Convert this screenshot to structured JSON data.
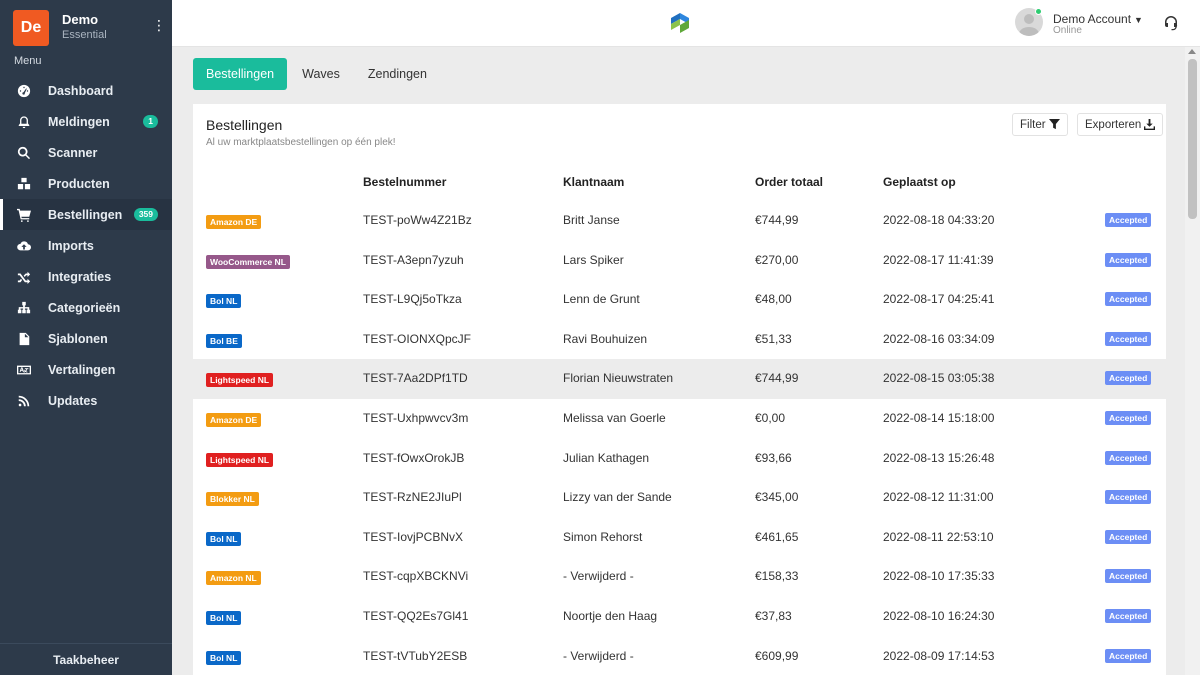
{
  "app": {
    "brand_initials": "De",
    "brand_name": "Demo",
    "brand_plan": "Essential",
    "menu_label": "Menu",
    "task_label": "Taakbeheer"
  },
  "sidebar": {
    "items": [
      {
        "label": "Dashboard",
        "icon": "dashboard-icon"
      },
      {
        "label": "Meldingen",
        "icon": "bell-icon",
        "badge": "1"
      },
      {
        "label": "Scanner",
        "icon": "search-icon"
      },
      {
        "label": "Producten",
        "icon": "boxes-icon"
      },
      {
        "label": "Bestellingen",
        "icon": "cart-icon",
        "badge": "359",
        "active": true
      },
      {
        "label": "Imports",
        "icon": "cloud-upload-icon"
      },
      {
        "label": "Integraties",
        "icon": "shuffle-icon"
      },
      {
        "label": "Categorieën",
        "icon": "sitemap-icon"
      },
      {
        "label": "Sjablonen",
        "icon": "file-icon"
      },
      {
        "label": "Vertalingen",
        "icon": "language-icon"
      },
      {
        "label": "Updates",
        "icon": "rss-icon"
      }
    ]
  },
  "header": {
    "account_name": "Demo Account",
    "account_status": "Online"
  },
  "tabs": [
    {
      "label": "Bestellingen",
      "active": true
    },
    {
      "label": "Waves"
    },
    {
      "label": "Zendingen"
    }
  ],
  "card": {
    "title": "Bestellingen",
    "subtitle": "Al uw marktplaatsbestellingen op één plek!",
    "filter_label": "Filter",
    "export_label": "Exporteren"
  },
  "table": {
    "columns": [
      "Bestelnummer",
      "Klantnaam",
      "Order totaal",
      "Geplaatst op"
    ],
    "marketplace_colors": {
      "Amazon DE": "#f39c12",
      "Amazon NL": "#f39c12",
      "WooCommerce NL": "#96588a",
      "Bol NL": "#0a68c8",
      "Bol BE": "#0a68c8",
      "Lightspeed NL": "#e02020",
      "Blokker NL": "#f39c12"
    },
    "rows": [
      {
        "marketplace": "Amazon DE",
        "order": "TEST-poWw4Z21Bz",
        "customer": "Britt Janse",
        "total": "€744,99",
        "date": "2022-08-18 04:33:20",
        "status": "Accepted"
      },
      {
        "marketplace": "WooCommerce NL",
        "order": "TEST-A3epn7yzuh",
        "customer": "Lars Spiker",
        "total": "€270,00",
        "date": "2022-08-17 11:41:39",
        "status": "Accepted"
      },
      {
        "marketplace": "Bol NL",
        "order": "TEST-L9Qj5oTkza",
        "customer": "Lenn de Grunt",
        "total": "€48,00",
        "date": "2022-08-17 04:25:41",
        "status": "Accepted"
      },
      {
        "marketplace": "Bol BE",
        "order": "TEST-OIONXQpcJF",
        "customer": "Ravi Bouhuizen",
        "total": "€51,33",
        "date": "2022-08-16 03:34:09",
        "status": "Accepted"
      },
      {
        "marketplace": "Lightspeed NL",
        "order": "TEST-7Aa2DPf1TD",
        "customer": "Florian Nieuwstraten",
        "total": "€744,99",
        "date": "2022-08-15 03:05:38",
        "status": "Accepted",
        "hover": true
      },
      {
        "marketplace": "Amazon DE",
        "order": "TEST-Uxhpwvcv3m",
        "customer": "Melissa van Goerle",
        "total": "€0,00",
        "date": "2022-08-14 15:18:00",
        "status": "Accepted"
      },
      {
        "marketplace": "Lightspeed NL",
        "order": "TEST-fOwxOrokJB",
        "customer": "Julian Kathagen",
        "total": "€93,66",
        "date": "2022-08-13 15:26:48",
        "status": "Accepted"
      },
      {
        "marketplace": "Blokker NL",
        "order": "TEST-RzNE2JIuPl",
        "customer": "Lizzy van der Sande",
        "total": "€345,00",
        "date": "2022-08-12 11:31:00",
        "status": "Accepted"
      },
      {
        "marketplace": "Bol NL",
        "order": "TEST-IovjPCBNvX",
        "customer": "Simon Rehorst",
        "total": "€461,65",
        "date": "2022-08-11 22:53:10",
        "status": "Accepted"
      },
      {
        "marketplace": "Amazon NL",
        "order": "TEST-cqpXBCKNVi",
        "customer": "- Verwijderd -",
        "total": "€158,33",
        "date": "2022-08-10 17:35:33",
        "status": "Accepted"
      },
      {
        "marketplace": "Bol NL",
        "order": "TEST-QQ2Es7Gl41",
        "customer": "Noortje den Haag",
        "total": "€37,83",
        "date": "2022-08-10 16:24:30",
        "status": "Accepted"
      },
      {
        "marketplace": "Bol NL",
        "order": "TEST-tVTubY2ESB",
        "customer": "- Verwijderd -",
        "total": "€609,99",
        "date": "2022-08-09 17:14:53",
        "status": "Accepted"
      }
    ]
  },
  "colors": {
    "accent": "#1abc9c",
    "sidebar_bg": "#2d3a4a",
    "status_accepted": "#6c8ef5",
    "brand": "#f05a22"
  }
}
